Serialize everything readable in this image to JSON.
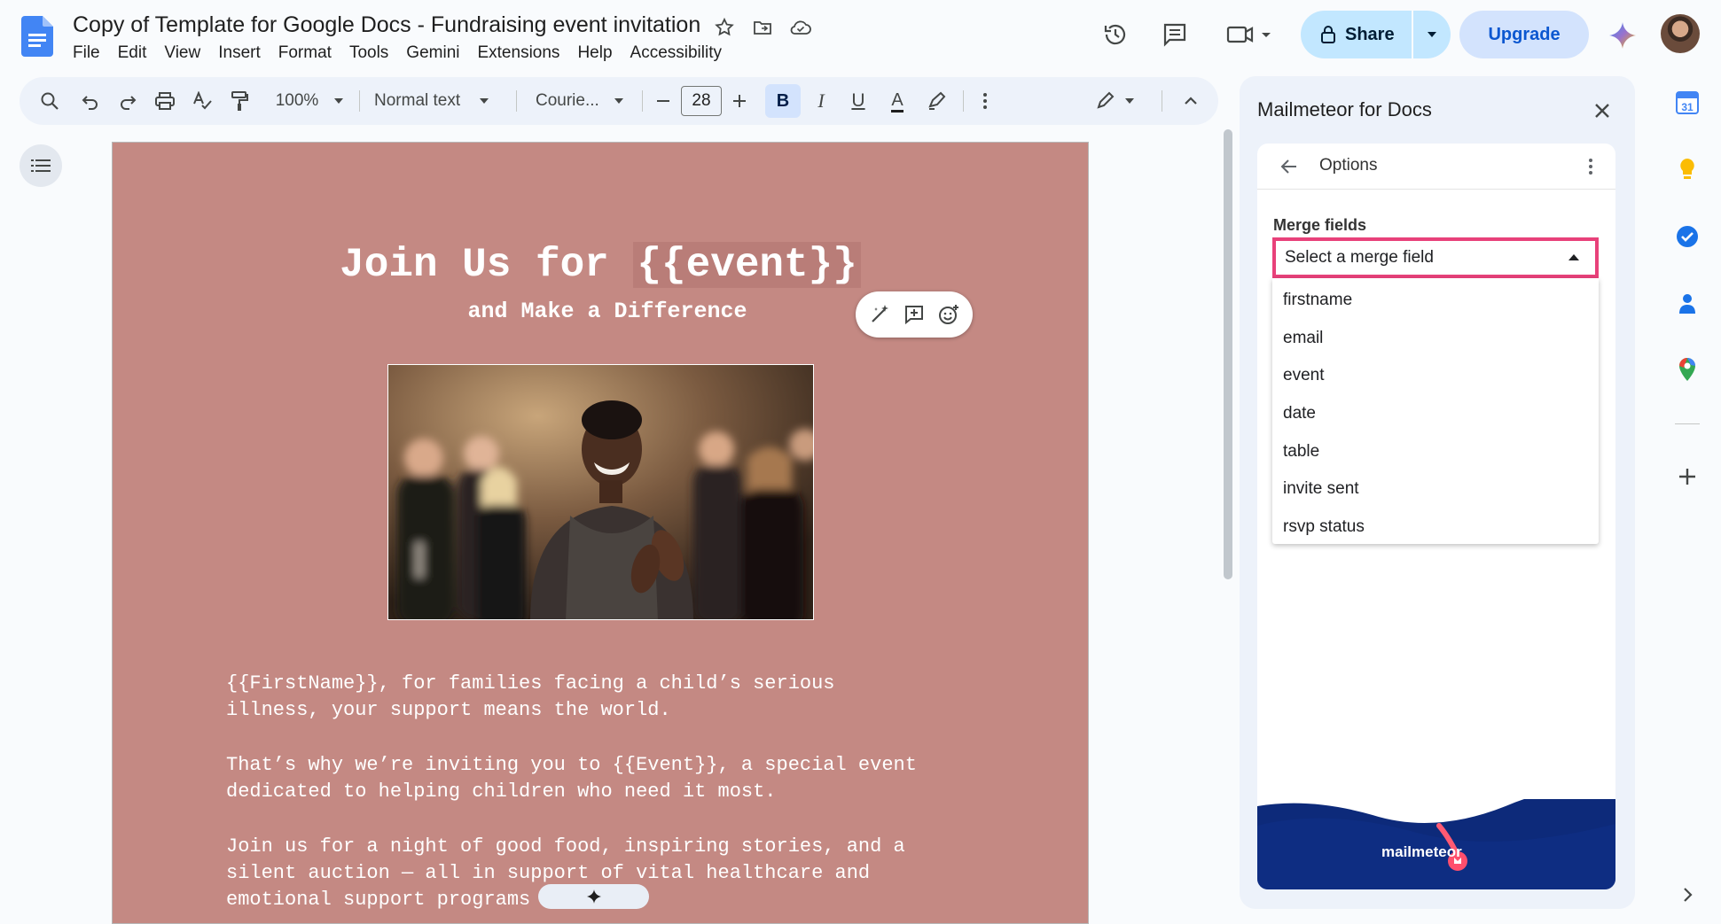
{
  "document": {
    "title": "Copy of Template for Google Docs - Fundraising event invitation",
    "menu": [
      "File",
      "Edit",
      "View",
      "Insert",
      "Format",
      "Tools",
      "Gemini",
      "Extensions",
      "Help",
      "Accessibility"
    ]
  },
  "header": {
    "share_label": "Share",
    "upgrade_label": "Upgrade"
  },
  "toolbar": {
    "zoom": "100%",
    "style": "Normal text",
    "font": "Courie...",
    "font_size": "28",
    "bold_label": "B",
    "italic_label": "I",
    "underline_label": "U",
    "text_color_label": "A"
  },
  "page": {
    "heading_before": "Join Us for ",
    "heading_highlight": "{{event}}",
    "subheading": "and Make a Difference",
    "paragraphs": [
      "{{FirstName}}, for families facing a child’s serious\nillness, your support means the world.",
      "That’s why we’re inviting you to {{Event}}, a special event\ndedicated to helping children who need it most.",
      "Join us for a night of good food, inspiring stories, and a\nsilent auction — all in support of vital healthcare and\nemotional support programs"
    ]
  },
  "panel": {
    "title": "Mailmeteor for Docs",
    "addon_header": "Options",
    "merge_label": "Merge fields",
    "merge_placeholder": "Select a merge field",
    "merge_options": [
      "firstname",
      "email",
      "event",
      "date",
      "table",
      "invite sent",
      "rsvp status"
    ],
    "footer_brand": "mailmeteor"
  },
  "rail": {
    "calendar_day": "31"
  },
  "colors": {
    "page_bg": "#c48983",
    "share_bg": "#c2e7ff",
    "upgrade_bg": "#d3e3fd",
    "merge_highlight": "#e8417a",
    "footer_wave": "#0d2a7a"
  }
}
